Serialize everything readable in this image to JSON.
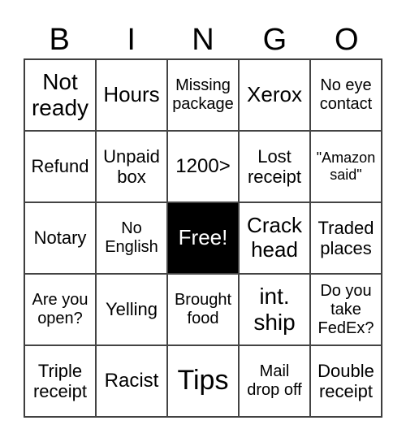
{
  "header": [
    "B",
    "I",
    "N",
    "G",
    "O"
  ],
  "cells": [
    {
      "text": "Not ready",
      "size": "s28"
    },
    {
      "text": "Hours",
      "size": "s26"
    },
    {
      "text": "Missing package",
      "size": "s20"
    },
    {
      "text": "Xerox",
      "size": "s26"
    },
    {
      "text": "No eye contact",
      "size": "s20"
    },
    {
      "text": "Refund",
      "size": "s22"
    },
    {
      "text": "Unpaid box",
      "size": "s22"
    },
    {
      "text": "1200>",
      "size": "s24"
    },
    {
      "text": "Lost receipt",
      "size": "s22"
    },
    {
      "text": "\"Amazon said\"",
      "size": "s18"
    },
    {
      "text": "Notary",
      "size": "s22"
    },
    {
      "text": "No English",
      "size": "s20"
    },
    {
      "text": "Free!",
      "size": "s26",
      "free": true
    },
    {
      "text": "Crack head",
      "size": "s26"
    },
    {
      "text": "Traded places",
      "size": "s22"
    },
    {
      "text": "Are you open?",
      "size": "s20"
    },
    {
      "text": "Yelling",
      "size": "s22"
    },
    {
      "text": "Brought food",
      "size": "s20"
    },
    {
      "text": "int. ship",
      "size": "s28"
    },
    {
      "text": "Do you take FedEx?",
      "size": "s20"
    },
    {
      "text": "Triple receipt",
      "size": "s22"
    },
    {
      "text": "Racist",
      "size": "s24"
    },
    {
      "text": "Tips",
      "size": "s32"
    },
    {
      "text": "Mail drop off",
      "size": "s20"
    },
    {
      "text": "Double receipt",
      "size": "s22"
    }
  ]
}
